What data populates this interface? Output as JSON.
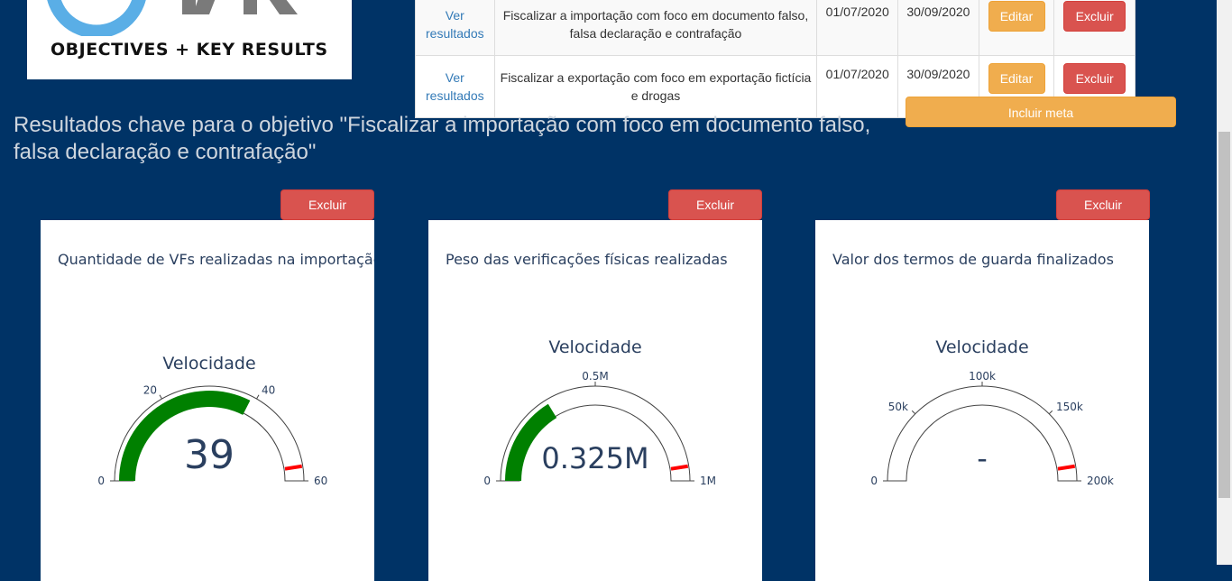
{
  "logo": {
    "tagline": "OBJECTIVES  +  KEY RESULTS"
  },
  "objectives_table": {
    "rows": [
      {
        "link": "Ver resultados",
        "description": "Fiscalizar a importação com foco em documento falso, falsa declaração e contrafação",
        "start_date": "01/07/2020",
        "end_date": "30/09/2020",
        "edit_label": "Editar",
        "delete_label": "Excluir"
      },
      {
        "link": "Ver resultados",
        "description": "Fiscalizar a exportação com foco em exportação fictícia e drogas",
        "start_date": "01/07/2020",
        "end_date": "30/09/2020",
        "edit_label": "Editar",
        "delete_label": "Excluir"
      }
    ]
  },
  "add_goal_label": "Incluir meta",
  "section_title": "Resultados chave para o objetivo \"Fiscalizar a importação com foco em documento falso, falsa declaração e contrafação\"",
  "key_results": [
    {
      "delete_label": "Excluir",
      "title": "Quantidade de VFs realizadas na importação",
      "gauge": {
        "title": "Velocidade",
        "value": 39,
        "value_text": "39",
        "min": 0,
        "max": 60,
        "threshold": 57,
        "ticks": [
          {
            "value": 0,
            "label": "0"
          },
          {
            "value": 20,
            "label": "20"
          },
          {
            "value": 40,
            "label": "40"
          },
          {
            "value": 60,
            "label": "60"
          }
        ],
        "bar_color": "#008000",
        "threshold_color": "#ff0000"
      }
    },
    {
      "delete_label": "Excluir",
      "title": "Peso das verificações físicas realizadas",
      "gauge": {
        "title": "Velocidade",
        "value": 325000,
        "value_text": "0.325M",
        "min": 0,
        "max": 1000000,
        "threshold": 950000,
        "ticks": [
          {
            "value": 0,
            "label": "0"
          },
          {
            "value": 500000,
            "label": "0.5M"
          },
          {
            "value": 1000000,
            "label": "1M"
          }
        ],
        "bar_color": "#008000",
        "threshold_color": "#ff0000"
      }
    },
    {
      "delete_label": "Excluir",
      "title": "Valor dos termos de guarda finalizados",
      "gauge": {
        "title": "Velocidade",
        "value": null,
        "value_text": "-",
        "min": 0,
        "max": 200000,
        "threshold": 190000,
        "ticks": [
          {
            "value": 0,
            "label": "0"
          },
          {
            "value": 50000,
            "label": "50k"
          },
          {
            "value": 100000,
            "label": "100k"
          },
          {
            "value": 150000,
            "label": "150k"
          },
          {
            "value": 200000,
            "label": "200k"
          }
        ],
        "bar_color": "#008000",
        "threshold_color": "#ff0000"
      }
    }
  ]
}
